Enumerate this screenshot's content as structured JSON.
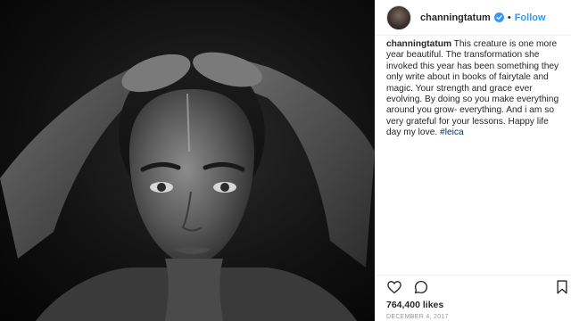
{
  "post": {
    "username": "channingtatum",
    "follow_label": "Follow",
    "caption_user": "channingtatum",
    "caption_text": " This creature is one more year beautiful. The transformation she invoked this year has been something they only write about in books of fairytale and magic. Your strength and grace ever evolving. By doing so you make everything around you grow- everything. And i am so very grateful for your lessons. Happy life day my love. ",
    "hashtag": "#leica",
    "likes": "764,400 likes",
    "date": "DECEMBER 4, 2017"
  },
  "colors": {
    "link_blue": "#3897f0",
    "hashtag": "#003569",
    "text": "#262626",
    "muted": "#999999"
  },
  "icons": [
    "verified-badge-icon",
    "heart-icon",
    "comment-icon",
    "bookmark-icon"
  ]
}
